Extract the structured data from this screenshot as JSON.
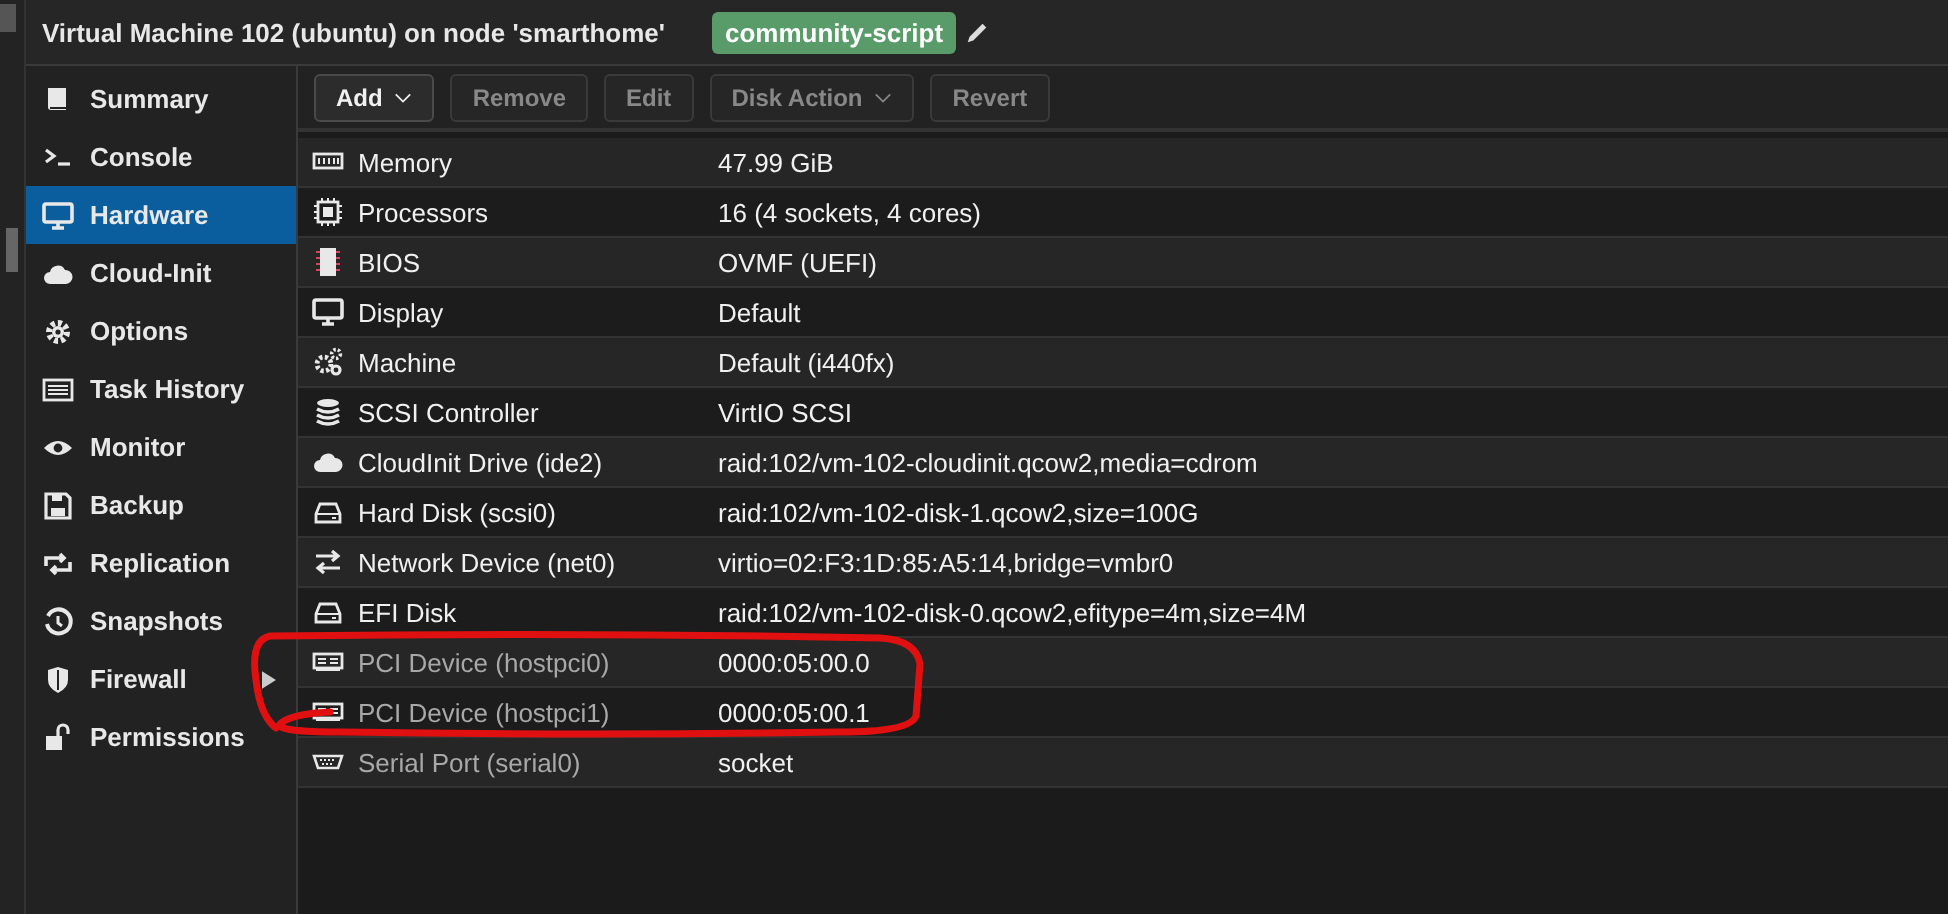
{
  "window": {
    "title": "Virtual Machine 102 (ubuntu) on node 'smarthome'",
    "tag": "community-script"
  },
  "sidebar": {
    "items": [
      {
        "label": "Summary",
        "selected": false
      },
      {
        "label": "Console",
        "selected": false
      },
      {
        "label": "Hardware",
        "selected": true
      },
      {
        "label": "Cloud-Init",
        "selected": false
      },
      {
        "label": "Options",
        "selected": false
      },
      {
        "label": "Task History",
        "selected": false
      },
      {
        "label": "Monitor",
        "selected": false
      },
      {
        "label": "Backup",
        "selected": false
      },
      {
        "label": "Replication",
        "selected": false
      },
      {
        "label": "Snapshots",
        "selected": false
      },
      {
        "label": "Firewall",
        "selected": false,
        "expandable": true
      },
      {
        "label": "Permissions",
        "selected": false
      }
    ]
  },
  "toolbar": [
    {
      "label": "Add",
      "disabled": false,
      "dropdown": true
    },
    {
      "label": "Remove",
      "disabled": true,
      "dropdown": false
    },
    {
      "label": "Edit",
      "disabled": true,
      "dropdown": false
    },
    {
      "label": "Disk Action",
      "disabled": true,
      "dropdown": true
    },
    {
      "label": "Revert",
      "disabled": true,
      "dropdown": false
    }
  ],
  "table": {
    "rows": [
      {
        "name": "Memory",
        "value": "47.99 GiB",
        "pending": false
      },
      {
        "name": "Processors",
        "value": "16 (4 sockets, 4 cores)",
        "pending": false
      },
      {
        "name": "BIOS",
        "value": "OVMF (UEFI)",
        "pending": false
      },
      {
        "name": "Display",
        "value": "Default",
        "pending": false
      },
      {
        "name": "Machine",
        "value": "Default (i440fx)",
        "pending": false
      },
      {
        "name": "SCSI Controller",
        "value": "VirtIO SCSI",
        "pending": false
      },
      {
        "name": "CloudInit Drive (ide2)",
        "value": "raid:102/vm-102-cloudinit.qcow2,media=cdrom",
        "pending": false
      },
      {
        "name": "Hard Disk (scsi0)",
        "value": "raid:102/vm-102-disk-1.qcow2,size=100G",
        "pending": false
      },
      {
        "name": "Network Device (net0)",
        "value": "virtio=02:F3:1D:85:A5:14,bridge=vmbr0",
        "pending": false
      },
      {
        "name": "EFI Disk",
        "value": "raid:102/vm-102-disk-0.qcow2,efitype=4m,size=4M",
        "pending": false
      },
      {
        "name": "PCI Device (hostpci0)",
        "value": "0000:05:00.0",
        "pending": true
      },
      {
        "name": "PCI Device (hostpci1)",
        "value": "0000:05:00.1",
        "pending": true
      },
      {
        "name": "Serial Port (serial0)",
        "value": "socket",
        "pending": true
      }
    ]
  }
}
